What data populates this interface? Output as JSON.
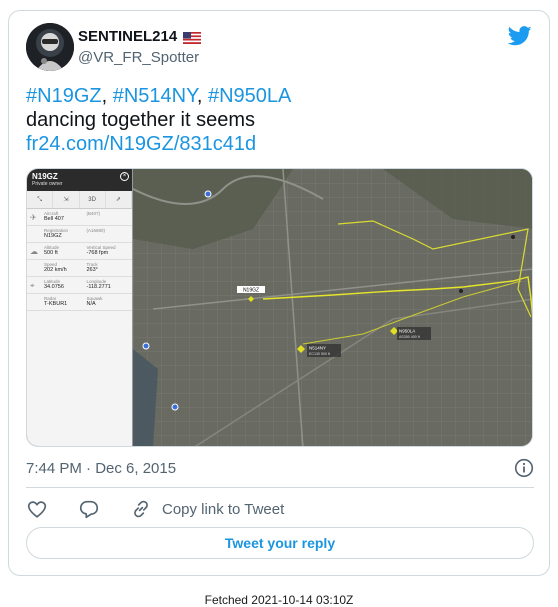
{
  "tweet": {
    "display_name": "SENTINEL214",
    "flag_icon": "us-flag-icon",
    "handle": "@VR_FR_Spotter",
    "hashtags": [
      "#N19GZ",
      "#N514NY",
      "#N950LA"
    ],
    "separator": ", ",
    "text_line2": "dancing together it seems",
    "link": "fr24.com/N19GZ/831c41d",
    "timestamp": "7:44 PM · Dec 6, 2015",
    "link_color": "#1b95e0"
  },
  "media": {
    "panel": {
      "title": "N19GZ",
      "subtitle": "Private owner",
      "tools": [
        "",
        "",
        "3D",
        ""
      ],
      "rows": [
        {
          "icon": "aircraft-icon",
          "cells": [
            {
              "label": "Aircraft",
              "value": "Bell 407"
            },
            {
              "label": "(B407)",
              "value": ""
            }
          ]
        },
        {
          "icon": "",
          "cells": [
            {
              "label": "Registration",
              "value": "N19GZ"
            },
            {
              "label": "(A16680)",
              "value": ""
            }
          ]
        },
        {
          "icon": "cloud-icon",
          "cells": [
            {
              "label": "Altitude",
              "value": "500 ft"
            },
            {
              "label": "Vertical Speed",
              "value": "-768 fpm"
            }
          ]
        },
        {
          "icon": "",
          "cells": [
            {
              "label": "Speed",
              "value": "202 km/h"
            },
            {
              "label": "Track",
              "value": "263°"
            }
          ]
        },
        {
          "icon": "location-icon",
          "cells": [
            {
              "label": "Latitude",
              "value": "34.0756"
            },
            {
              "label": "Longitude",
              "value": "-118.2771"
            }
          ]
        },
        {
          "icon": "",
          "cells": [
            {
              "label": "Radar",
              "value": "T-KBUR1"
            },
            {
              "label": "Squawk",
              "value": "N/A"
            }
          ]
        }
      ]
    },
    "map_labels": {
      "n19gz": "N19GZ",
      "n514ny": "N514NY",
      "n514ny_sub": "EC130 500 ft",
      "n950la": "N950LA",
      "n950la_sub": "AS350 400 ft"
    }
  },
  "actions": {
    "like_icon": "heart-icon",
    "reply_icon": "reply-bubble-icon",
    "copy_icon": "link-icon",
    "copy_label": "Copy link to Tweet",
    "reply_button": "Tweet your reply"
  },
  "footer": {
    "fetched": "Fetched 2021-10-14 03:10Z"
  }
}
